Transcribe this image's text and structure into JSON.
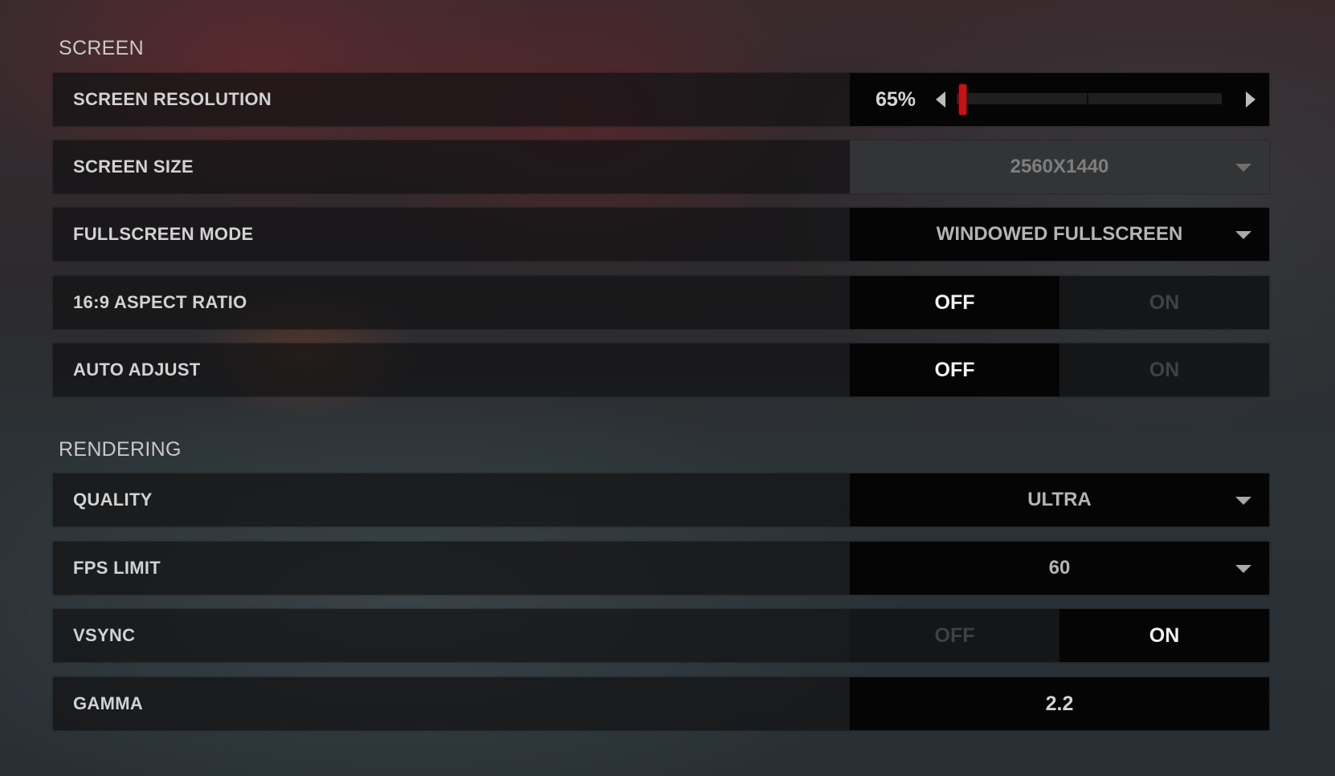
{
  "sections": [
    {
      "title": "SCREEN",
      "rows": [
        {
          "label": "SCREEN RESOLUTION",
          "type": "slider",
          "value": "65%",
          "fraction": 0.02
        },
        {
          "label": "SCREEN SIZE",
          "type": "dropdown",
          "value": "2560X1440",
          "disabled": true
        },
        {
          "label": "FULLSCREEN MODE",
          "type": "dropdown",
          "value": "WINDOWED FULLSCREEN"
        },
        {
          "label": "16:9 ASPECT RATIO",
          "type": "toggle",
          "off_label": "OFF",
          "on_label": "ON",
          "state": "OFF"
        },
        {
          "label": "AUTO ADJUST",
          "type": "toggle",
          "off_label": "OFF",
          "on_label": "ON",
          "state": "OFF"
        }
      ]
    },
    {
      "title": "RENDERING",
      "rows": [
        {
          "label": "QUALITY",
          "type": "dropdown",
          "value": "ULTRA"
        },
        {
          "label": "FPS LIMIT",
          "type": "dropdown",
          "value": "60"
        },
        {
          "label": "VSYNC",
          "type": "toggle",
          "off_label": "OFF",
          "on_label": "ON",
          "state": "ON"
        },
        {
          "label": "GAMMA",
          "type": "value",
          "value": "2.2"
        }
      ]
    }
  ],
  "icons": {
    "slider_decrease": "caret-left-icon",
    "slider_increase": "caret-right-icon",
    "dropdown": "chevron-down-icon"
  },
  "colors": {
    "slider_thumb": "#c11418",
    "active_toggle_bg": "#050505",
    "inactive_toggle_bg": "#141617",
    "active_text": "#f2f2f2",
    "inactive_text": "#3e4244"
  }
}
